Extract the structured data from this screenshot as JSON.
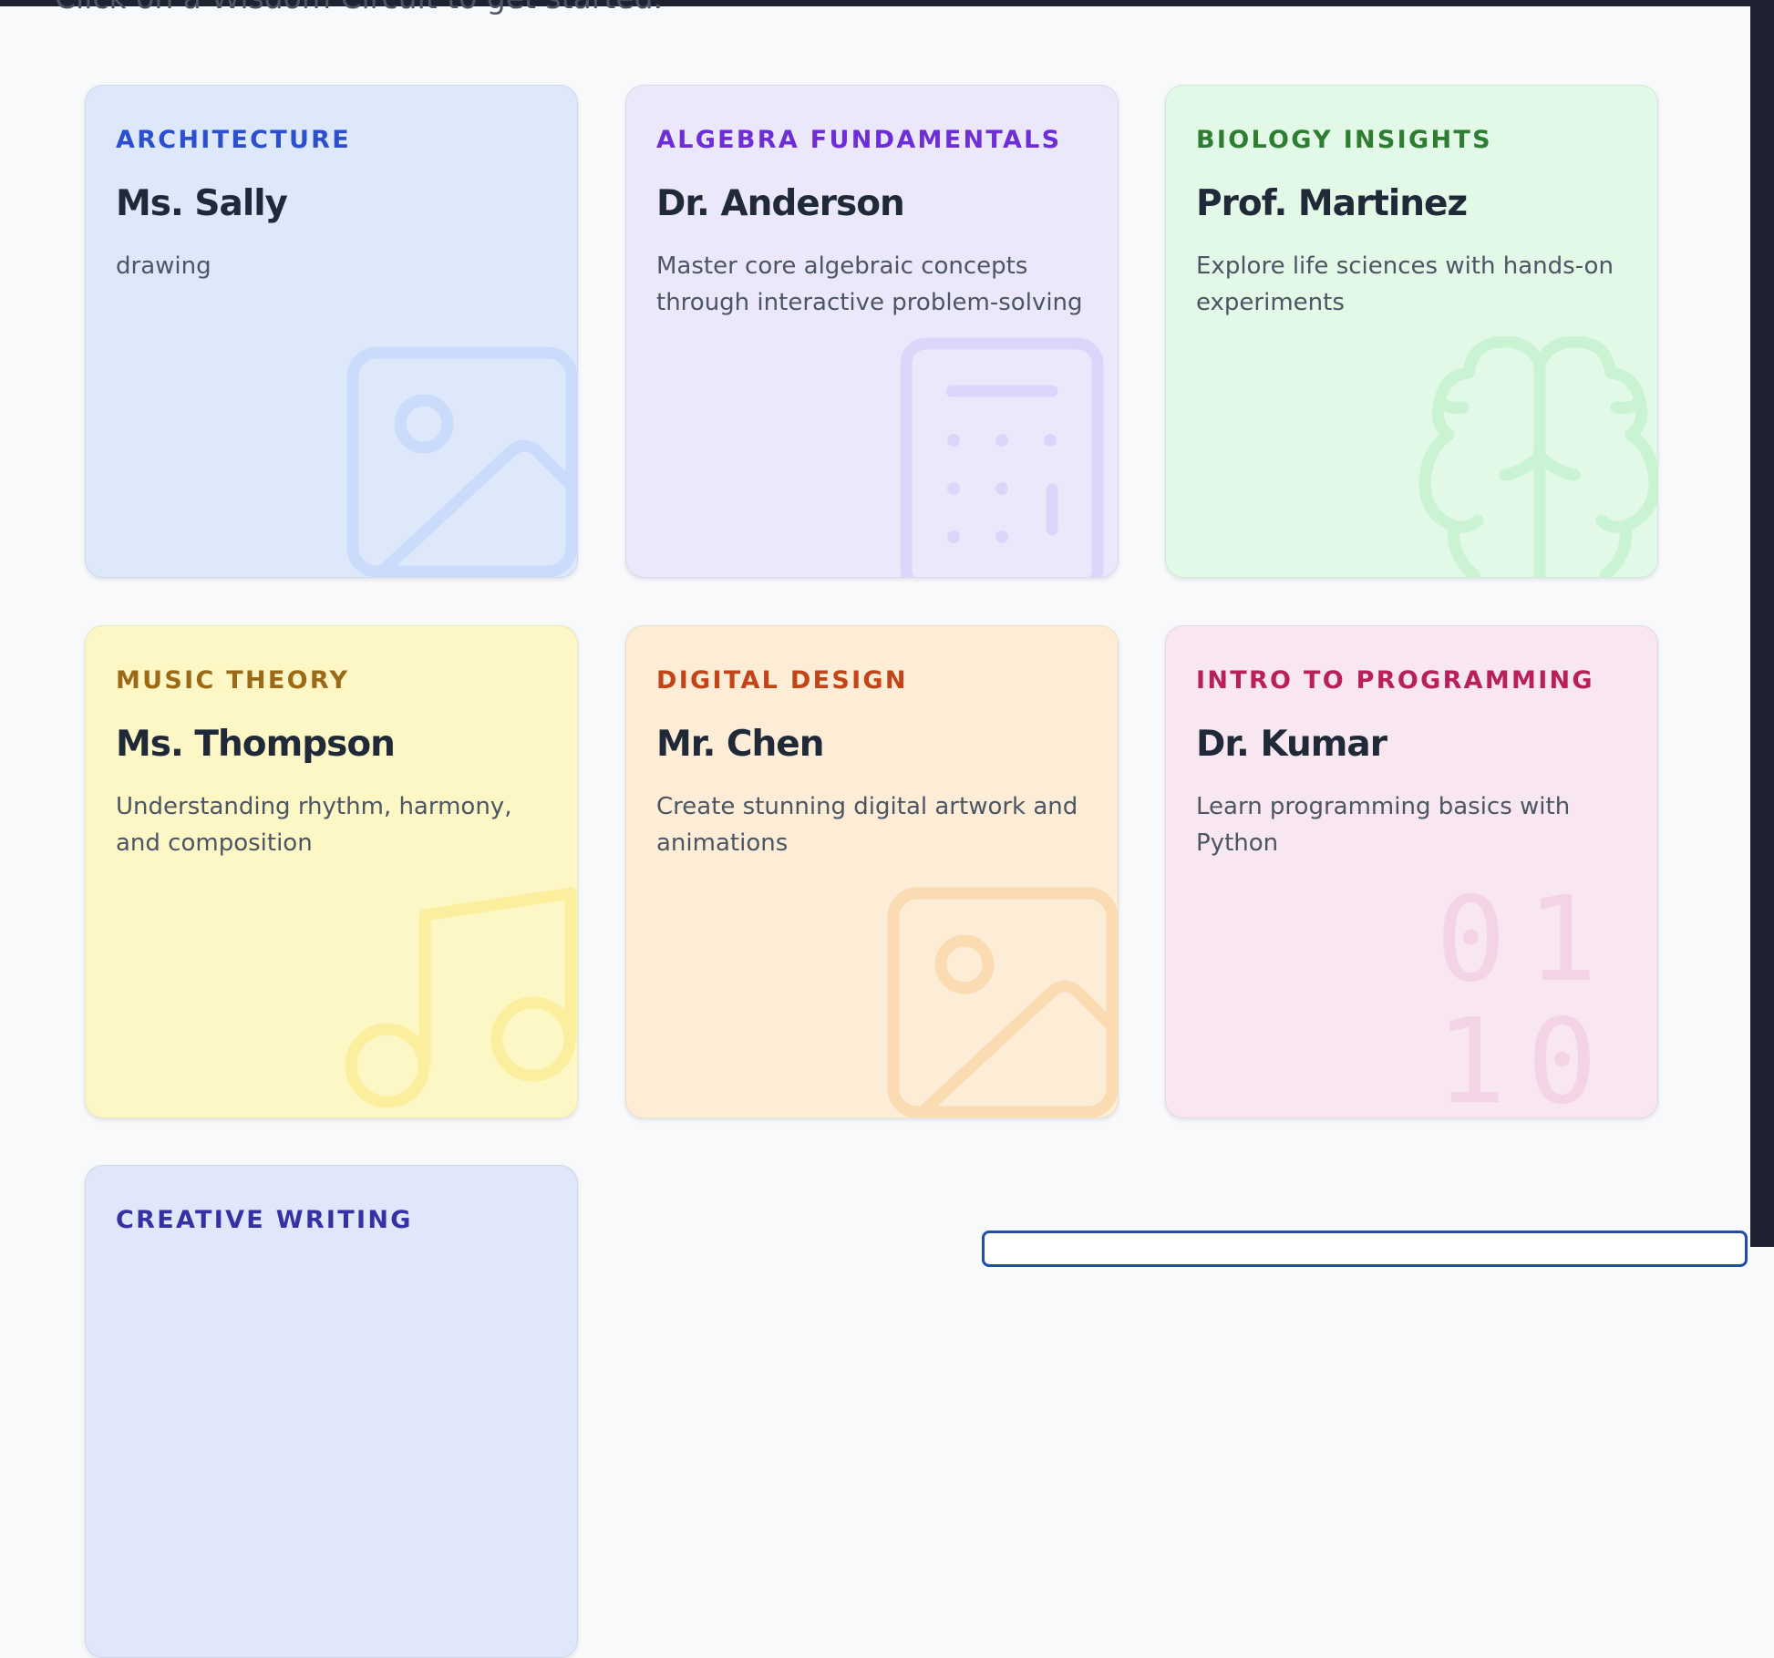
{
  "intro_text": "Click on a Wisdom Circuit to get started.",
  "cards": [
    {
      "subject": "ARCHITECTURE",
      "teacher": "Ms. Sally",
      "description": "drawing",
      "icon": "image-icon",
      "color": "#2c4fce"
    },
    {
      "subject": "ALGEBRA FUNDAMENTALS",
      "teacher": "Dr. Anderson",
      "description": "Master core algebraic concepts through interactive problem-solving",
      "icon": "calculator-icon",
      "color": "#6d2ed5"
    },
    {
      "subject": "BIOLOGY INSIGHTS",
      "teacher": "Prof. Martinez",
      "description": "Explore life sciences with hands-on experiments",
      "icon": "brain-icon",
      "color": "#2f7d32"
    },
    {
      "subject": "MUSIC THEORY",
      "teacher": "Ms. Thompson",
      "description": "Understanding rhythm, harmony, and composition",
      "icon": "music-note-icon",
      "color": "#9c6a16"
    },
    {
      "subject": "DIGITAL DESIGN",
      "teacher": "Mr. Chen",
      "description": "Create stunning digital artwork and animations",
      "icon": "image-icon",
      "color": "#c2451a"
    },
    {
      "subject": "INTRO TO PROGRAMMING",
      "teacher": "Dr. Kumar",
      "description": "Learn programming basics with Python",
      "icon": "binary-icon",
      "color": "#b8205c"
    },
    {
      "subject": "CREATIVE WRITING",
      "icon": "pen-icon",
      "color": "#3730a3"
    }
  ],
  "binary_digits": [
    "0",
    "1",
    "1",
    "0"
  ]
}
